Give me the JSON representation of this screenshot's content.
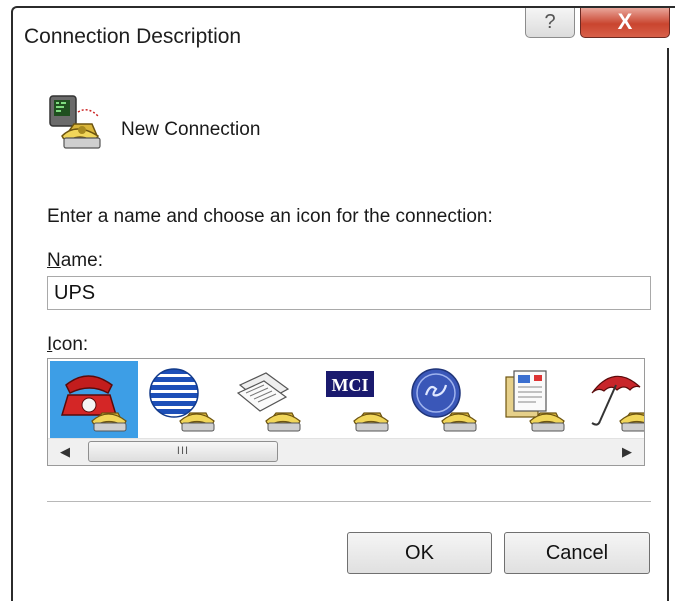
{
  "window": {
    "title": "Connection Description",
    "help_label": "?",
    "close_label": "X"
  },
  "header": {
    "label": "New Connection",
    "icon": "phone-terminal-icon"
  },
  "form": {
    "instructions": "Enter a name and choose an icon for the connection:",
    "name_label_first": "N",
    "name_label_rest": "ame:",
    "name_value": "UPS",
    "icon_label_first": "I",
    "icon_label_rest": "con:"
  },
  "icons": [
    {
      "name": "red-telephone-icon",
      "selected": true
    },
    {
      "name": "globe-stripes-icon",
      "selected": false
    },
    {
      "name": "newspaper-icon",
      "selected": false
    },
    {
      "name": "mci-logo-icon",
      "label": "MCI",
      "selected": false
    },
    {
      "name": "ge-logo-icon",
      "selected": false
    },
    {
      "name": "documents-icon",
      "selected": false
    },
    {
      "name": "umbrella-icon",
      "selected": false
    }
  ],
  "scrollbar": {
    "left_arrow": "◀",
    "right_arrow": "▶",
    "thumb_grip": "III"
  },
  "buttons": {
    "ok": "OK",
    "cancel": "Cancel"
  },
  "colors": {
    "selection": "#3d9ee6",
    "close_button": "#c9452f"
  }
}
